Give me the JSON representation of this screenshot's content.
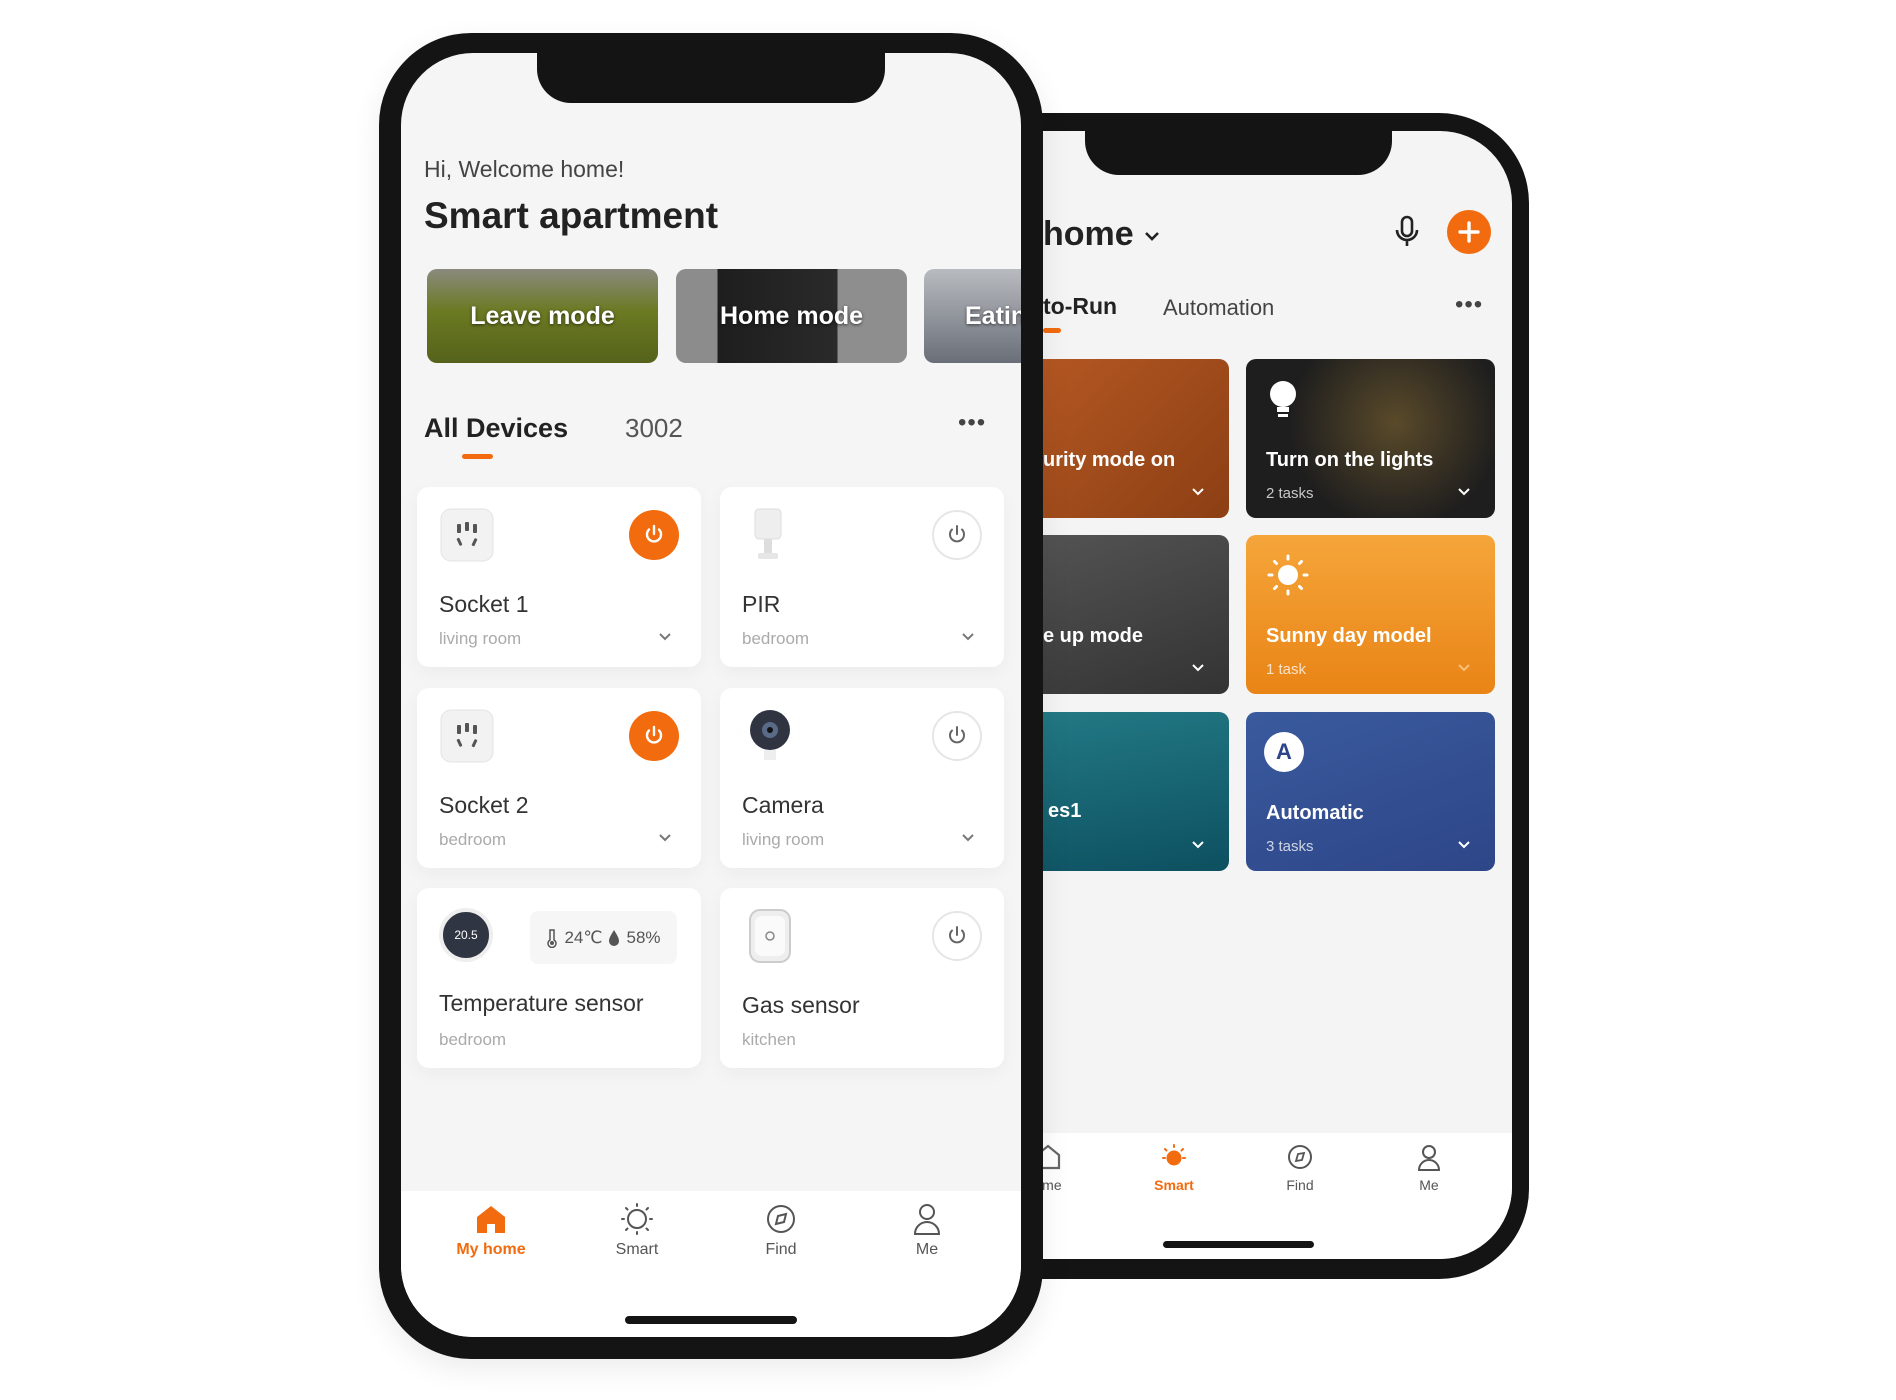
{
  "front": {
    "greeting": "Hi, Welcome home!",
    "title": "Smart apartment",
    "scenes": [
      {
        "label": "Leave mode"
      },
      {
        "label": "Home mode"
      },
      {
        "label": "Eatin"
      }
    ],
    "tabs": {
      "active": "All Devices",
      "other": "3002"
    },
    "devices": [
      {
        "name": "Socket 1",
        "room": "living room",
        "power": "on"
      },
      {
        "name": "PIR",
        "room": "bedroom",
        "power": "off"
      },
      {
        "name": "Socket 2",
        "room": "bedroom",
        "power": "on"
      },
      {
        "name": "Camera",
        "room": "living room",
        "power": "off"
      },
      {
        "name": "Temperature sensor",
        "room": "bedroom",
        "dial": "20.5",
        "temperature": "24℃",
        "humidity": "58%"
      },
      {
        "name": "Gas sensor",
        "room": "kitchen",
        "power": "off"
      }
    ],
    "nav": [
      {
        "label": "My home",
        "active": true
      },
      {
        "label": "Smart"
      },
      {
        "label": "Find"
      },
      {
        "label": "Me"
      }
    ]
  },
  "back": {
    "home_title": "home",
    "tabs": {
      "active": "to-Run",
      "other": "Automation"
    },
    "scenes": [
      {
        "title": "urity mode on",
        "subtitle": ""
      },
      {
        "title": "Turn on the lights",
        "subtitle": "2 tasks"
      },
      {
        "title": "e up mode",
        "subtitle": ""
      },
      {
        "title": "Sunny day model",
        "subtitle": "1 task"
      },
      {
        "title": "es1",
        "subtitle": ""
      },
      {
        "title": "Automatic",
        "subtitle": "3 tasks",
        "badge": "A"
      }
    ],
    "nav": [
      {
        "label": "ome"
      },
      {
        "label": "Smart",
        "active": true
      },
      {
        "label": "Find"
      },
      {
        "label": "Me"
      }
    ]
  },
  "colors": {
    "accent": "#f26b0f",
    "text": "#222222",
    "muted": "#aaaaaa",
    "background": "#f5f5f5"
  }
}
